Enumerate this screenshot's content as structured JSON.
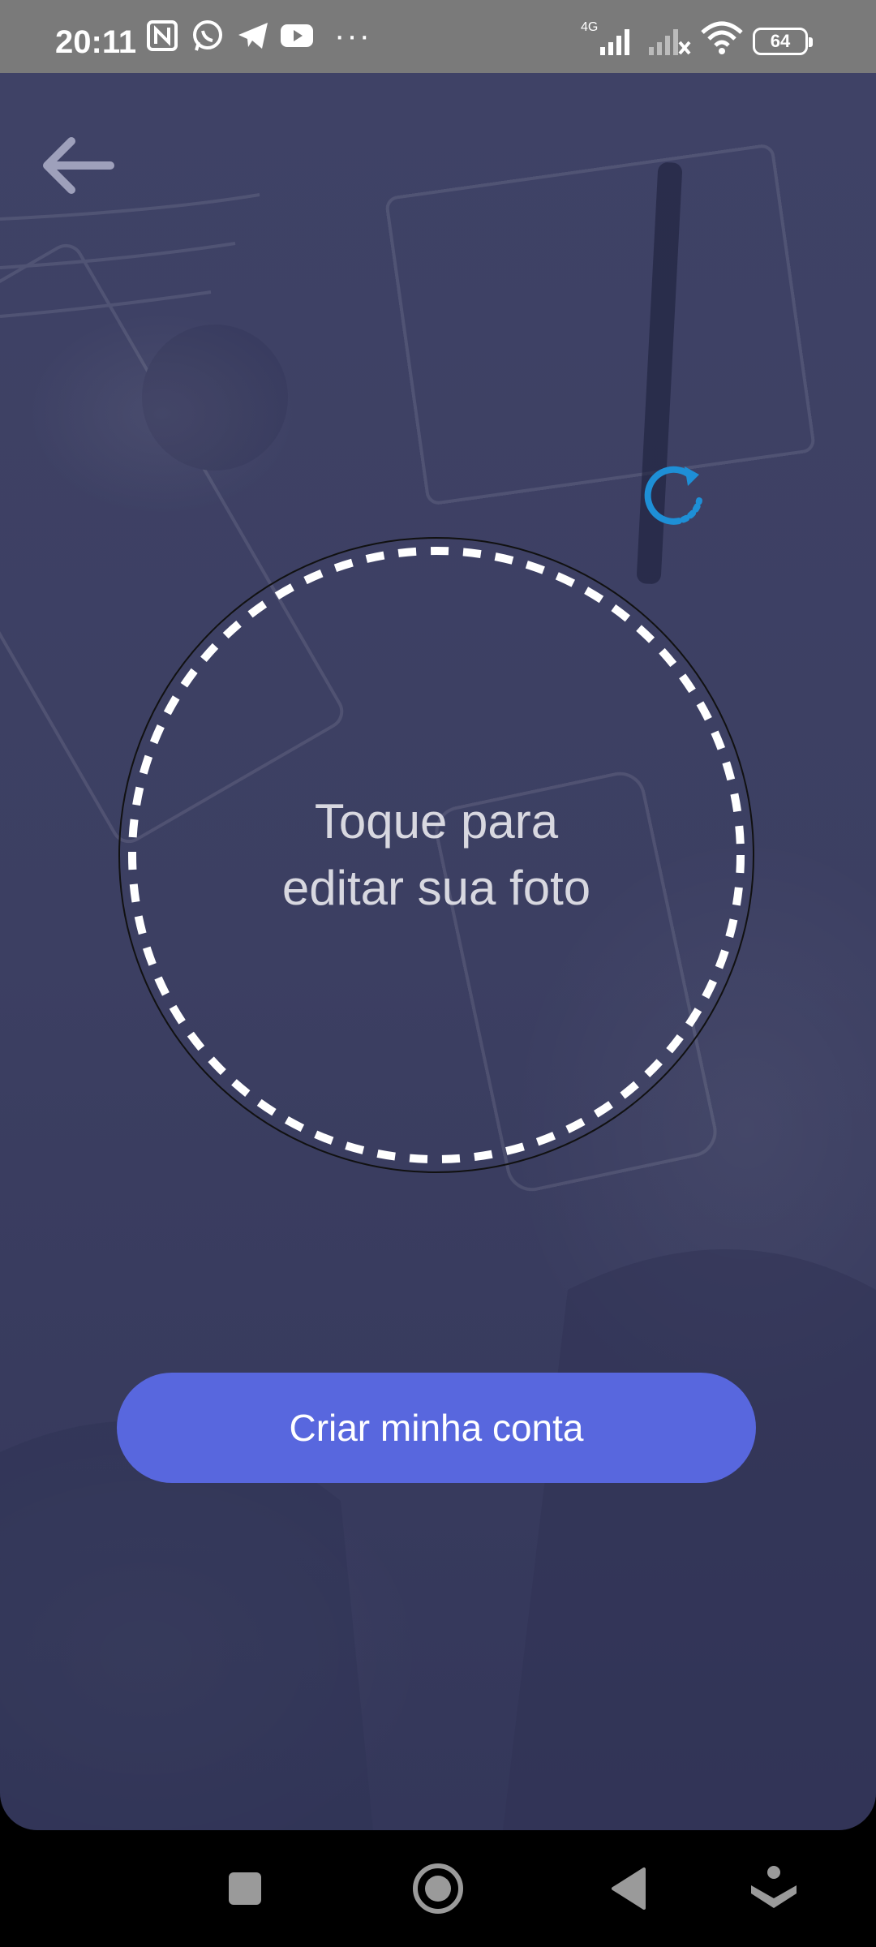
{
  "status_bar": {
    "time": "20:11",
    "network_label": "4G",
    "battery": "64",
    "notification_icons": [
      "nfc-icon",
      "whatsapp-icon",
      "telegram-icon",
      "youtube-icon",
      "more-dots-icon"
    ]
  },
  "header": {
    "back_icon": "arrow-left-icon",
    "refresh_icon": "refresh-icon"
  },
  "photo": {
    "prompt": "Toque para\neditar sua foto"
  },
  "actions": {
    "create_account": "Criar minha conta"
  },
  "navigation": {
    "items": [
      "recents-square-icon",
      "home-circle-icon",
      "back-triangle-icon",
      "assistant-icon"
    ]
  },
  "colors": {
    "overlay": "#3f4266",
    "primary_button": "#5867de",
    "refresh_accent": "#1e8fd6",
    "status_bar": "#7a7a7a"
  }
}
